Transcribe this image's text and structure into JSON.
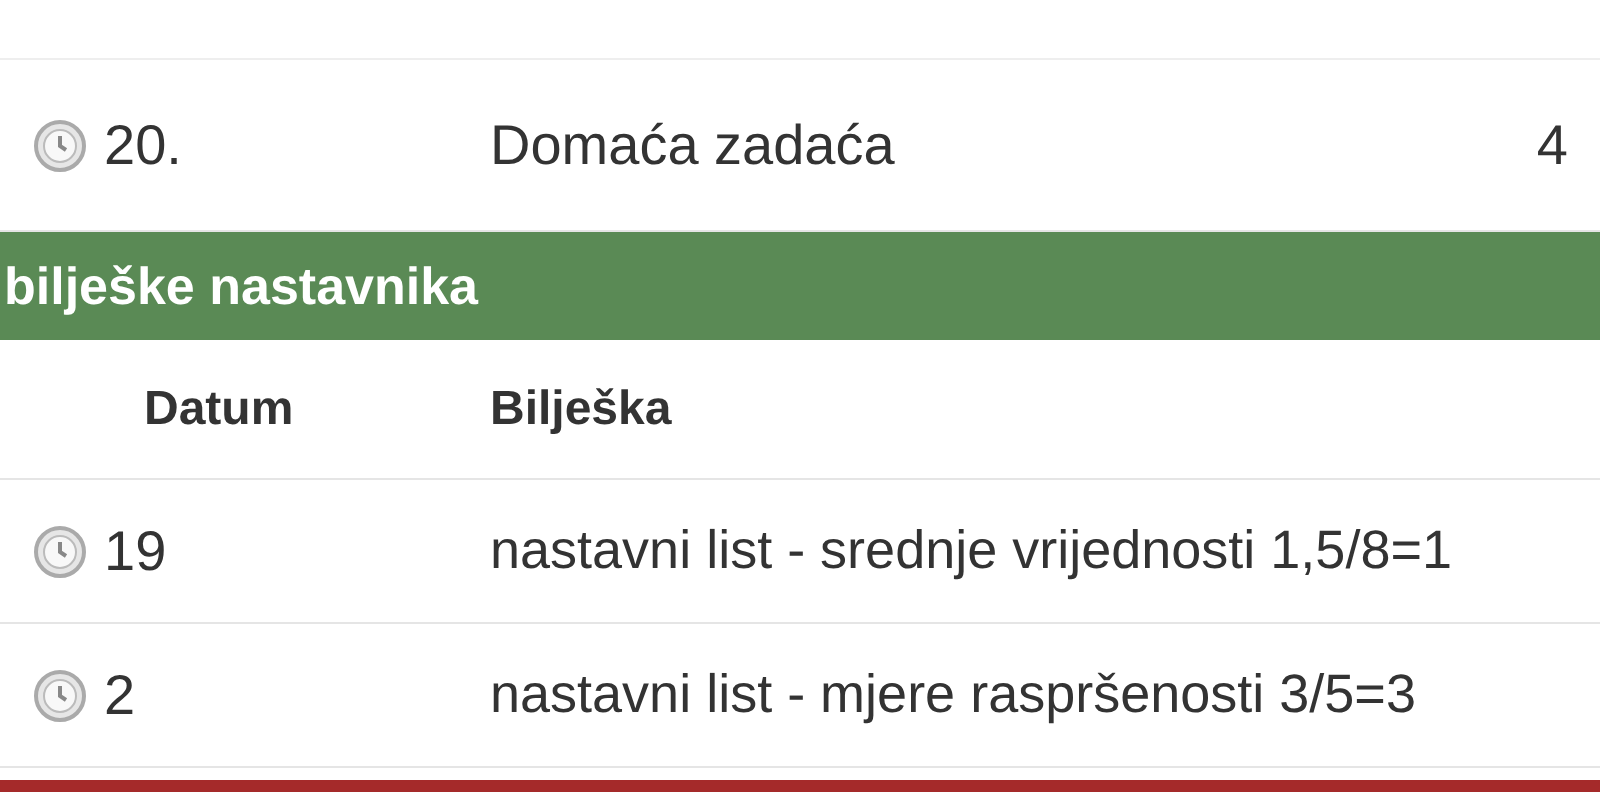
{
  "grades_table": {
    "rows": [
      {
        "date": "20.",
        "note": "Domaća zadaća",
        "grade": "4"
      }
    ]
  },
  "teacher_notes": {
    "title": "bilješke nastavnika",
    "columns": [
      "Datum",
      "Bilješka"
    ],
    "rows": [
      {
        "date": "19",
        "note": "nastavni list - srednje vrijednosti 1,5/8=1"
      },
      {
        "date": "2",
        "note": "nastavni list - mjere raspršenosti 3/5=3"
      }
    ]
  }
}
